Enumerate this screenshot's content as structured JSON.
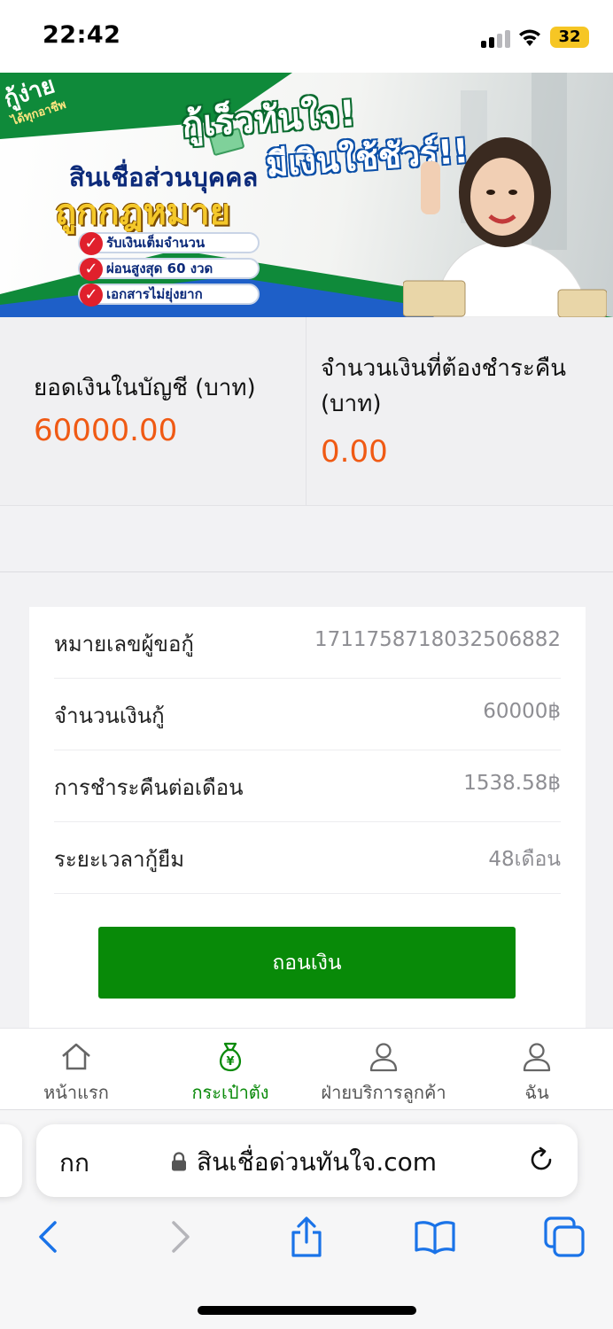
{
  "status_bar": {
    "time": "22:42",
    "battery": "32"
  },
  "banner": {
    "corner_main": "กู้ง่าย",
    "corner_small": "ได้ทุกอาชีพ",
    "headline_1": "กู้เร็วทันใจ!",
    "headline_2": "มีเงินใช้ชัวร์!!",
    "subtitle": "สินเชื่อส่วนบุคคล",
    "legal": "ถูกกฎหมาย",
    "features": [
      "รับเงินเต็มจำนวน",
      "ผ่อนสูงสุด 60 งวด",
      "เอกสารไม่ยุ่งยาก"
    ]
  },
  "balance": {
    "account_label": "ยอดเงินในบัญชี (บาท)",
    "account_value": "60000.00",
    "repay_label": "จำนวนเงินที่ต้องชำระคืน (บาท)",
    "repay_value": "0.00"
  },
  "loan_details": [
    {
      "label": "หมายเลขผู้ขอกู้",
      "value": "1711758718032506882"
    },
    {
      "label": "จำนวนเงินกู้",
      "value": "60000฿"
    },
    {
      "label": "การชำระคืนต่อเดือน",
      "value": "1538.58฿"
    },
    {
      "label": "ระยะเวลากู้ยืม",
      "value": "48เดือน"
    }
  ],
  "withdraw_button": "ถอนเงิน",
  "tabs": [
    {
      "label": "หน้าแรก",
      "icon": "home-icon"
    },
    {
      "label": "กระเป๋าตัง",
      "icon": "money-bag-icon",
      "active": true
    },
    {
      "label": "ฝ่ายบริการลูกค้า",
      "icon": "person-icon"
    },
    {
      "label": "ฉัน",
      "icon": "profile-icon"
    }
  ],
  "safari": {
    "text_size_label": "กก",
    "url": "สินเชื่อด่วนทันใจ.com"
  },
  "colors": {
    "accent_orange": "#f05a14",
    "button_green": "#088a08",
    "active_tab": "#0a8a0a",
    "safari_blue": "#1a73e8"
  }
}
